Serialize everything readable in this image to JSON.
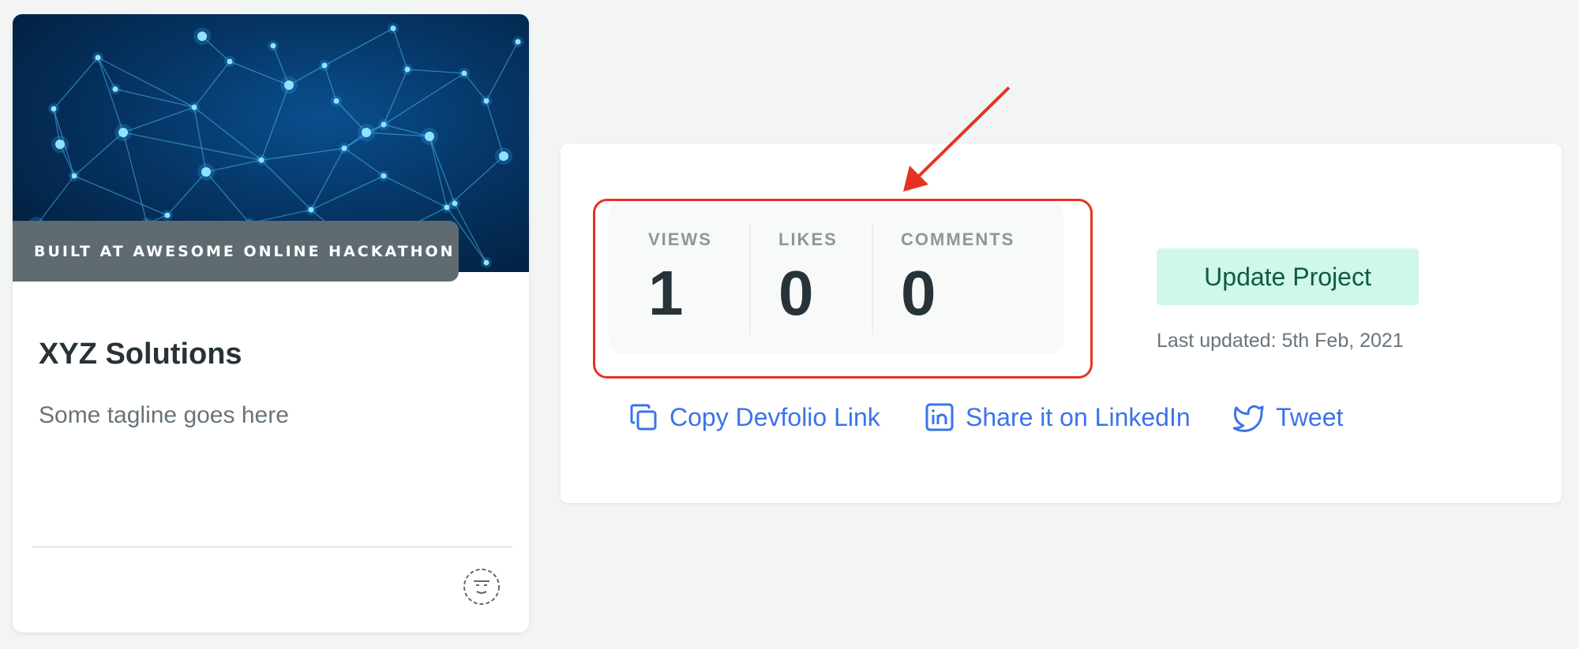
{
  "project_card": {
    "badge": "BUILT AT AWESOME ONLINE HACKATHON",
    "title": "XYZ Solutions",
    "tagline": "Some tagline goes here",
    "cover_icon": "network-graph-image",
    "avatar_icon": "user-avatar-icon"
  },
  "stats": {
    "views_label": "VIEWS",
    "views_value": "1",
    "likes_label": "LIKES",
    "likes_value": "0",
    "comments_label": "COMMENTS",
    "comments_value": "0"
  },
  "actions": {
    "update_label": "Update Project",
    "last_updated": "Last updated: 5th Feb, 2021"
  },
  "share": {
    "copy_label": "Copy Devfolio Link",
    "linkedin_label": "Share it on LinkedIn",
    "tweet_label": "Tweet"
  },
  "colors": {
    "link": "#3b73ea",
    "accent_button_bg": "#cff8e9",
    "accent_button_text": "#0e5a44",
    "highlight": "#e53323",
    "background": "#f3f4f4"
  }
}
